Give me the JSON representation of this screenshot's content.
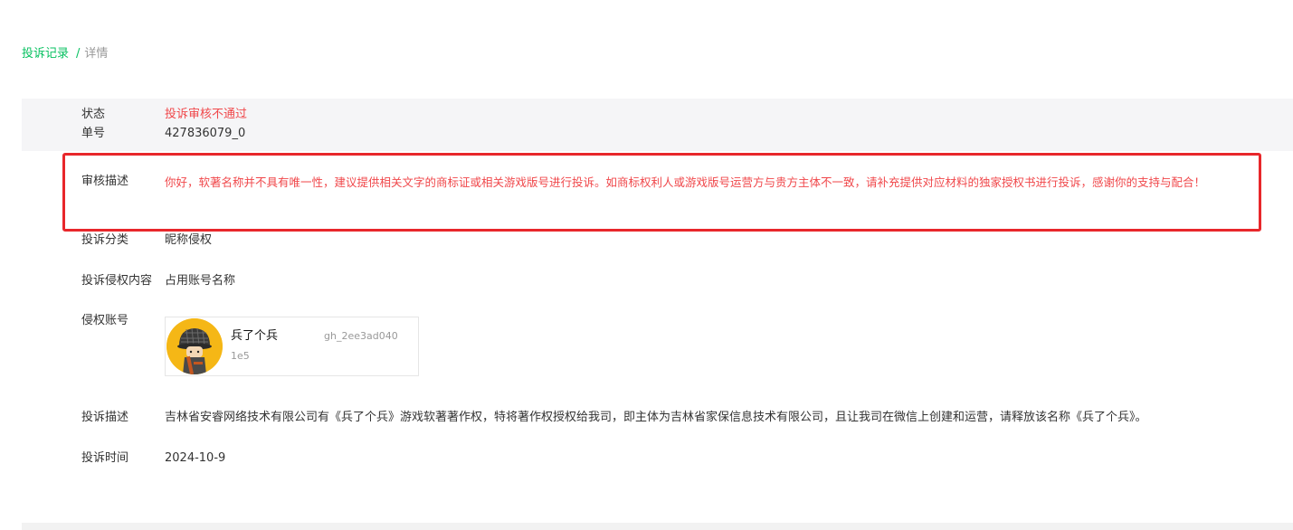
{
  "breadcrumb": {
    "parent": "投诉记录",
    "separator": "/",
    "current": "详情"
  },
  "status": {
    "label": "状态",
    "value": "投诉审核不通过"
  },
  "order": {
    "label": "单号",
    "value": "427836079_0"
  },
  "review": {
    "label": "审核描述",
    "text": "你好，软著名称并不具有唯一性，建议提供相关文字的商标证或相关游戏版号进行投诉。如商标权利人或游戏版号运营方与贵方主体不一致，请补充提供对应材料的独家授权书进行投诉，感谢你的支持与配合！"
  },
  "category": {
    "label": "投诉分类",
    "value": "昵称侵权"
  },
  "content": {
    "label": "投诉侵权内容",
    "value": "占用账号名称"
  },
  "account": {
    "label": "侵权账号",
    "name": "兵了个兵",
    "id_part1": "gh_2ee3ad040",
    "id_part2": "1e5"
  },
  "description": {
    "label": "投诉描述",
    "value": "吉林省安睿网络技术有限公司有《兵了个兵》游戏软著著作权，特将著作权授权给我司，即主体为吉林省家保信息技术有限公司，且让我司在微信上创建和运营，请释放该名称《兵了个兵》。"
  },
  "time": {
    "label": "投诉时间",
    "value": "2024-10-9"
  },
  "colors": {
    "accent": "#07c160",
    "error": "#f0484b",
    "highlight_border": "#e8272b",
    "status_bg": "#f5f5f7"
  }
}
